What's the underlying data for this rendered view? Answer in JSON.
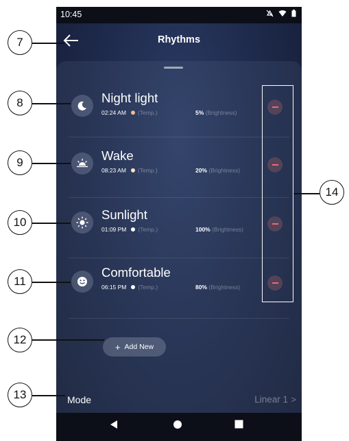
{
  "status_bar": {
    "time": "10:45",
    "icons": [
      "mute-icon",
      "wifi-icon",
      "battery-icon"
    ]
  },
  "header": {
    "title": "Rhythms"
  },
  "rhythms": [
    {
      "name": "Night light",
      "time": "02:24 AM",
      "temp_label": "(Temp.)",
      "brightness": "5%",
      "brightness_label": "(Brightness)",
      "icon": "moon-icon",
      "temp_color": "#f6b98a"
    },
    {
      "name": "Wake",
      "time": "08:23 AM",
      "temp_label": "(Temp.)",
      "brightness": "20%",
      "brightness_label": "(Brightness)",
      "icon": "sunrise-icon",
      "temp_color": "#fbe3b8"
    },
    {
      "name": "Sunlight",
      "time": "01:09 PM",
      "temp_label": "(Temp.)",
      "brightness": "100%",
      "brightness_label": "(Brightness)",
      "icon": "sun-icon",
      "temp_color": "#ffffff"
    },
    {
      "name": "Comfortable",
      "time": "06:15 PM",
      "temp_label": "(Temp.)",
      "brightness": "80%",
      "brightness_label": "(Brightness)",
      "icon": "smiley-icon",
      "temp_color": "#ffffff"
    }
  ],
  "add_button": {
    "plus": "+",
    "label": "Add New"
  },
  "mode": {
    "label": "Mode",
    "value": "Linear 1",
    "chevron": ">"
  },
  "callouts": [
    "7",
    "8",
    "9",
    "10",
    "11",
    "12",
    "13",
    "14"
  ],
  "colors": {
    "remove": "#e86c78",
    "background": "#1f2b4d"
  }
}
